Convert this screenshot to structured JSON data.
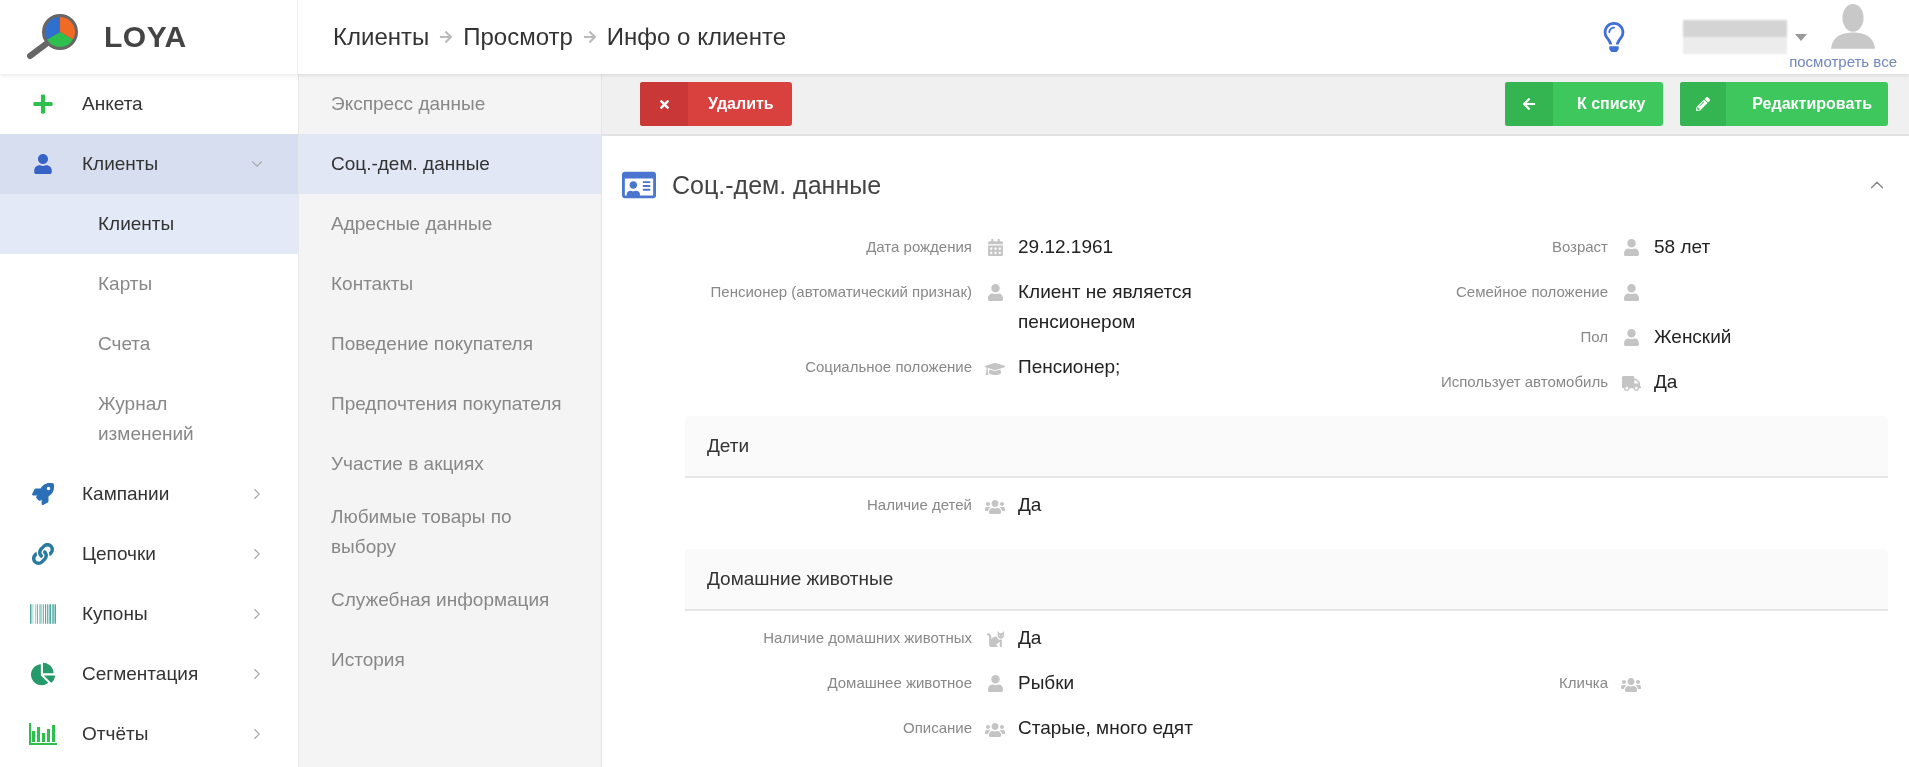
{
  "app": {
    "name": "LOYA"
  },
  "breadcrumb": [
    "Клиенты",
    "Просмотр",
    "Инфо о клиенте"
  ],
  "header": {
    "overlay_link": "посмотреть все"
  },
  "sidebar": {
    "items": [
      {
        "label": "Анкета",
        "selected": false
      },
      {
        "label": "Клиенты",
        "selected": true,
        "expanded": true,
        "children": [
          {
            "label": "Клиенты",
            "selected": true
          },
          {
            "label": "Карты",
            "selected": false
          },
          {
            "label": "Счета",
            "selected": false
          },
          {
            "label": "Журнал изменений",
            "selected": false
          }
        ]
      },
      {
        "label": "Кампании",
        "selected": false,
        "expanded": false
      },
      {
        "label": "Цепочки",
        "selected": false,
        "expanded": false
      },
      {
        "label": "Купоны",
        "selected": false,
        "expanded": false
      },
      {
        "label": "Сегментация",
        "selected": false,
        "expanded": false
      },
      {
        "label": "Отчёты",
        "selected": false,
        "expanded": false
      }
    ]
  },
  "subnav": [
    {
      "label": "Экспресс данные",
      "selected": false
    },
    {
      "label": "Соц.-дем. данные",
      "selected": true
    },
    {
      "label": "Адресные данные",
      "selected": false
    },
    {
      "label": "Контакты",
      "selected": false
    },
    {
      "label": "Поведение покупателя",
      "selected": false
    },
    {
      "label": "Предпочтения покупателя",
      "selected": false
    },
    {
      "label": "Участие в акциях",
      "selected": false
    },
    {
      "label": "Любимые товары по выбору",
      "selected": false
    },
    {
      "label": "Служебная информация",
      "selected": false
    },
    {
      "label": "История",
      "selected": false
    }
  ],
  "toolbar": {
    "delete_button": "Удалить",
    "back_button": "К списку",
    "edit_button": "Редактировать"
  },
  "section": {
    "title": "Соц.-дем. данные",
    "expanded": true,
    "left": [
      {
        "label": "Дата рождения",
        "value": "29.12.1961"
      },
      {
        "label": "Пенсионер (автоматический признак)",
        "value": "Клиент не является пенсионером"
      },
      {
        "label": "Социальное положение",
        "value": "Пенсионер;"
      }
    ],
    "right": [
      {
        "label": "Возраст",
        "value": "58 лет"
      },
      {
        "label": "Семейное положение"
      },
      {
        "label": "Пол",
        "value": "Женский"
      },
      {
        "label": "Использует автомобиль",
        "value": "Да"
      }
    ],
    "groups": [
      {
        "title": "Дети",
        "left": [
          {
            "label": "Наличие детей",
            "value": "Да"
          }
        ]
      },
      {
        "title": "Домашние животные",
        "left": [
          {
            "label": "Наличие домашних животных",
            "value": "Да"
          },
          {
            "label": "Домашнее животное",
            "value": "Рыбки"
          },
          {
            "label": "Описание",
            "value": "Старые, много едят"
          }
        ],
        "right": [
          {
            "label": "Кличка"
          }
        ]
      }
    ]
  }
}
